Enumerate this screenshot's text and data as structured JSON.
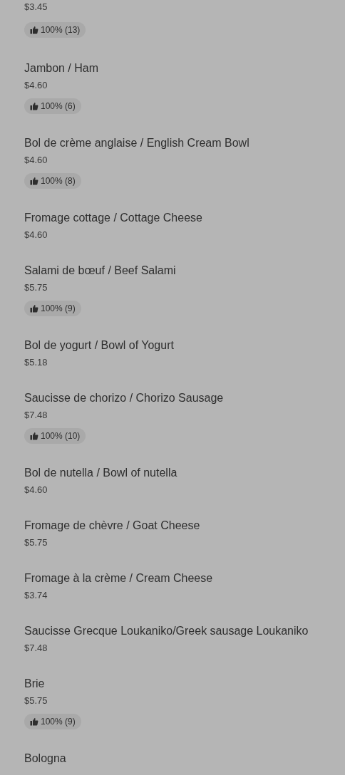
{
  "items": [
    {
      "price": "$3.45",
      "rating": "100% (13)"
    },
    {
      "name": "Jambon / Ham",
      "price": "$4.60",
      "rating": "100% (6)"
    },
    {
      "name": "Bol de crème anglaise / English Cream Bowl",
      "price": "$4.60",
      "rating": "100% (8)"
    },
    {
      "name": "Fromage cottage / Cottage Cheese",
      "price": "$4.60"
    },
    {
      "name": "Salami de bœuf / Beef Salami",
      "price": "$5.75",
      "rating": "100% (9)"
    },
    {
      "name": "Bol de yogurt / Bowl of Yogurt",
      "price": "$5.18"
    },
    {
      "name": "Saucisse de chorizo / Chorizo Sausage",
      "price": "$7.48",
      "rating": "100% (10)"
    },
    {
      "name": "Bol de nutella / Bowl of nutella",
      "price": "$4.60"
    },
    {
      "name": "Fromage de chèvre / Goat Cheese",
      "price": "$5.75"
    },
    {
      "name": "Fromage à la crème / Cream Cheese",
      "price": "$3.74"
    },
    {
      "name": "Saucisse Grecque Loukaniko/Greek sausage Loukaniko",
      "price": "$7.48"
    },
    {
      "name": "Brie",
      "price": "$5.75",
      "rating": "100% (9)"
    },
    {
      "name": "Bologna"
    }
  ]
}
